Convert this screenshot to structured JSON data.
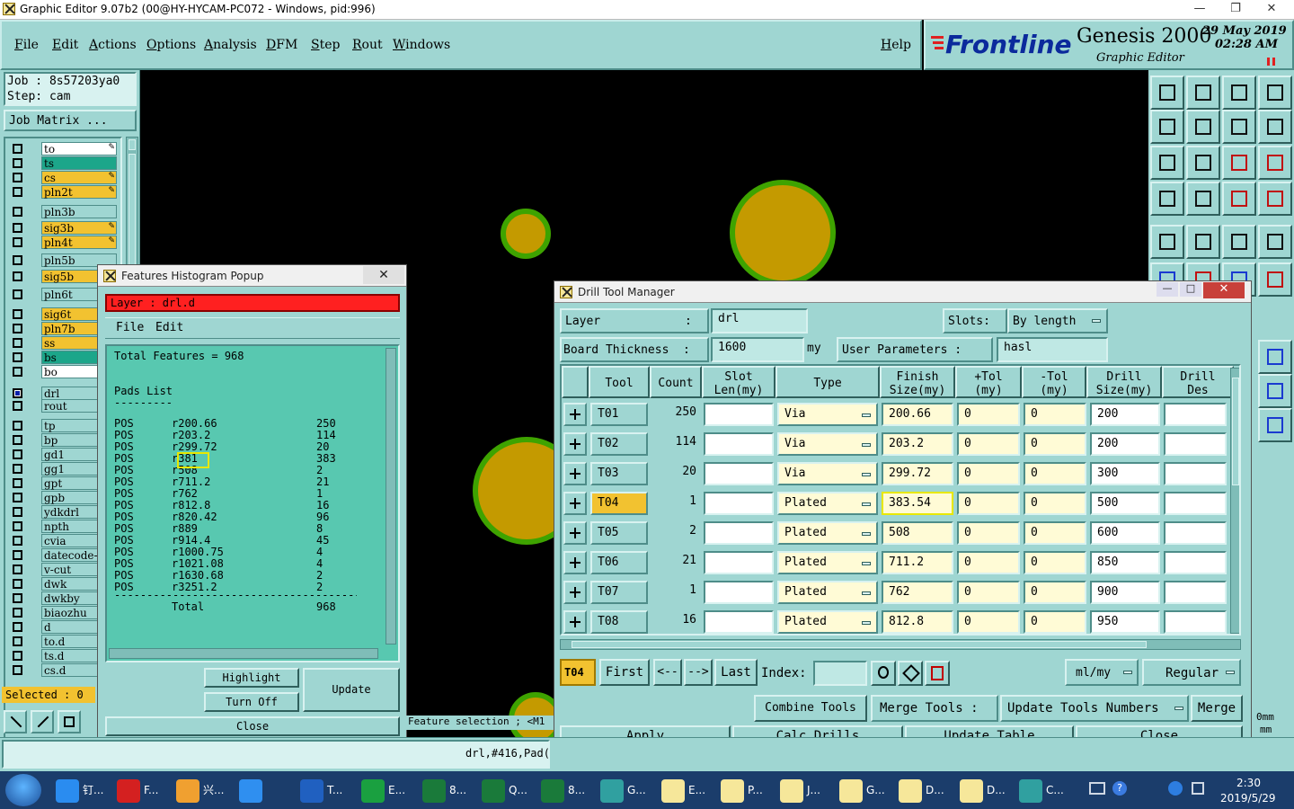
{
  "app": {
    "title": "Graphic Editor 9.07b2 (00@HY-HYCAM-PC072 - Windows, pid:996)",
    "menus": [
      "File",
      "Edit",
      "Actions",
      "Options",
      "Analysis",
      "DFM",
      "Step",
      "Rout",
      "Windows"
    ],
    "help": "Help",
    "brand": "Frontline",
    "product": "Genesis 2000",
    "subtitle": "Graphic Editor",
    "date": "29 May 2019",
    "time": "02:28 AM"
  },
  "left": {
    "job": "Job : 8s57203ya0",
    "step": "Step: cam",
    "job_matrix": "Job Matrix ...",
    "layers": [
      {
        "name": "to",
        "color": "#ffffff",
        "flag": "✎"
      },
      {
        "name": "ts",
        "color": "#1ca68a",
        "flag": ""
      },
      {
        "name": "cs",
        "color": "#f2c230",
        "flag": "✎"
      },
      {
        "name": "pln2t",
        "color": "#f2c230",
        "flag": "✎"
      },
      {
        "name": "pln3b",
        "color": "#9fd6d2",
        "flag": ""
      },
      {
        "name": "sig3b",
        "color": "#f2c230",
        "flag": "✎"
      },
      {
        "name": "pln4t",
        "color": "#f2c230",
        "flag": "✎"
      },
      {
        "name": "pln5b",
        "color": "#9fd6d2",
        "flag": ""
      },
      {
        "name": "sig5b",
        "color": "#f2c230",
        "flag": ""
      },
      {
        "name": "pln6t",
        "color": "#9fd6d2",
        "flag": ""
      },
      {
        "name": "sig6t",
        "color": "#f2c230",
        "flag": ""
      },
      {
        "name": "pln7b",
        "color": "#f2c230",
        "flag": ""
      },
      {
        "name": "ss",
        "color": "#f2c230",
        "flag": ""
      },
      {
        "name": "bs",
        "color": "#1ca68a",
        "flag": ""
      },
      {
        "name": "bo",
        "color": "#ffffff",
        "flag": ""
      },
      {
        "name": "drl",
        "color": "#9fd6d2",
        "flag": ""
      },
      {
        "name": "rout",
        "color": "#9fd6d2",
        "flag": ""
      },
      {
        "name": "tp",
        "color": "#9fd6d2",
        "flag": ""
      },
      {
        "name": "bp",
        "color": "#9fd6d2",
        "flag": ""
      },
      {
        "name": "gd1",
        "color": "#9fd6d2",
        "flag": ""
      },
      {
        "name": "gg1",
        "color": "#9fd6d2",
        "flag": ""
      },
      {
        "name": "gpt",
        "color": "#9fd6d2",
        "flag": ""
      },
      {
        "name": "gpb",
        "color": "#9fd6d2",
        "flag": ""
      },
      {
        "name": "ydkdrl",
        "color": "#9fd6d2",
        "flag": ""
      },
      {
        "name": "npth",
        "color": "#9fd6d2",
        "flag": ""
      },
      {
        "name": "cvia",
        "color": "#9fd6d2",
        "flag": ""
      },
      {
        "name": "datecode-",
        "color": "#9fd6d2",
        "flag": ""
      },
      {
        "name": "v-cut",
        "color": "#9fd6d2",
        "flag": ""
      },
      {
        "name": "dwk",
        "color": "#9fd6d2",
        "flag": ""
      },
      {
        "name": "dwkby",
        "color": "#9fd6d2",
        "flag": ""
      },
      {
        "name": "biaozhu",
        "color": "#9fd6d2",
        "flag": ""
      },
      {
        "name": "d",
        "color": "#9fd6d2",
        "flag": ""
      },
      {
        "name": "to.d",
        "color": "#9fd6d2",
        "flag": ""
      },
      {
        "name": "ts.d",
        "color": "#9fd6d2",
        "flag": ""
      },
      {
        "name": "cs.d",
        "color": "#9fd6d2",
        "flag": ""
      }
    ],
    "selected": "Selected : 0"
  },
  "histogram": {
    "title": "Features Histogram Popup",
    "layer": "Layer :  drl.d",
    "file": "File",
    "edit": "Edit",
    "total_features": "Total Features = 968",
    "pads_list": "Pads List",
    "underline": "---------",
    "rows": [
      [
        "POS",
        "r200.66",
        "250"
      ],
      [
        "POS",
        "r203.2",
        "114"
      ],
      [
        "POS",
        "r299.72",
        "20"
      ],
      [
        "POS",
        "r381",
        "383"
      ],
      [
        "POS",
        "r508",
        "2"
      ],
      [
        "POS",
        "r711.2",
        "21"
      ],
      [
        "POS",
        "r762",
        "1"
      ],
      [
        "POS",
        "r812.8",
        "16"
      ],
      [
        "POS",
        "r820.42",
        "96"
      ],
      [
        "POS",
        "r889",
        "8"
      ],
      [
        "POS",
        "r914.4",
        "45"
      ],
      [
        "POS",
        "r1000.75",
        "4"
      ],
      [
        "POS",
        "r1021.08",
        "4"
      ],
      [
        "POS",
        "r1630.68",
        "2"
      ],
      [
        "POS",
        "r3251.2",
        "2"
      ]
    ],
    "separator": "-----------------------------------------",
    "total_label": "Total",
    "total_value": "968",
    "highlight": "Highlight",
    "turn_off": "Turn Off",
    "update": "Update",
    "close": "Close"
  },
  "dtm": {
    "title": "Drill Tool Manager",
    "layer_label": "Layer            :",
    "layer_value": "drl",
    "slots_label": "Slots:",
    "slots_value": "By length",
    "board_label": "Board Thickness  :",
    "board_value": "1600",
    "board_unit": "my",
    "user_params_label": "User Parameters :",
    "user_params_value": "hasl",
    "headers": [
      "Tool",
      "Count",
      "Slot\nLen(my)",
      "Type",
      "Finish\nSize(my)",
      "+Tol\n(my)",
      "-Tol\n(my)",
      "Drill\nSize(my)",
      "Drill\nDes"
    ],
    "rows": [
      {
        "tool": "T01",
        "count": "250",
        "type": "Via",
        "finish": "200.66",
        "ptol": "0",
        "ntol": "0",
        "drill": "200"
      },
      {
        "tool": "T02",
        "count": "114",
        "type": "Via",
        "finish": "203.2",
        "ptol": "0",
        "ntol": "0",
        "drill": "200"
      },
      {
        "tool": "T03",
        "count": "20",
        "type": "Via",
        "finish": "299.72",
        "ptol": "0",
        "ntol": "0",
        "drill": "300"
      },
      {
        "tool": "T04",
        "count": "1",
        "type": "Plated",
        "finish": "383.54",
        "ptol": "0",
        "ntol": "0",
        "drill": "500"
      },
      {
        "tool": "T05",
        "count": "2",
        "type": "Plated",
        "finish": "508",
        "ptol": "0",
        "ntol": "0",
        "drill": "600"
      },
      {
        "tool": "T06",
        "count": "21",
        "type": "Plated",
        "finish": "711.2",
        "ptol": "0",
        "ntol": "0",
        "drill": "850"
      },
      {
        "tool": "T07",
        "count": "1",
        "type": "Plated",
        "finish": "762",
        "ptol": "0",
        "ntol": "0",
        "drill": "900"
      },
      {
        "tool": "T08",
        "count": "16",
        "type": "Plated",
        "finish": "812.8",
        "ptol": "0",
        "ntol": "0",
        "drill": "950"
      }
    ],
    "current_tool": "T04",
    "nav": [
      "First",
      "<--",
      "-->",
      "Last"
    ],
    "index_label": "Index:",
    "units": "ml/my",
    "mode": "Regular",
    "combine": "Combine Tools",
    "merge_tools": "Merge Tools :",
    "update_numbers": "Update Tools Numbers",
    "merge": "Merge",
    "apply": "Apply",
    "calc": "Calc Drills",
    "update_table": "Update Table",
    "close": "Close"
  },
  "status": {
    "feature_selection": "Feature selection ; <M1",
    "pad_info": "drl,#416,Pad(",
    "right_hint1": "0mm",
    "right_hint2": "mm"
  },
  "taskbar": {
    "tasks": [
      {
        "label": "钉...",
        "color": "#2a8cf0"
      },
      {
        "label": "F...",
        "color": "#d42020"
      },
      {
        "label": "兴...",
        "color": "#f0a030"
      },
      {
        "label": "",
        "color": "#2f8ff0"
      },
      {
        "label": "T...",
        "color": "#2060c0"
      },
      {
        "label": "E...",
        "color": "#1aa040"
      },
      {
        "label": "8...",
        "color": "#1a7a3a"
      },
      {
        "label": "Q...",
        "color": "#1a7a3a"
      },
      {
        "label": "8...",
        "color": "#1a7a3a"
      },
      {
        "label": "G...",
        "color": "#30a0a0"
      },
      {
        "label": "E...",
        "color": "#f6e79a"
      },
      {
        "label": "P...",
        "color": "#f6e79a"
      },
      {
        "label": "J...",
        "color": "#f6e79a"
      },
      {
        "label": "G...",
        "color": "#f6e79a"
      },
      {
        "label": "D...",
        "color": "#f6e79a"
      },
      {
        "label": "D...",
        "color": "#f6e79a"
      },
      {
        "label": "C...",
        "color": "#30a0a0"
      }
    ],
    "clock_time": "2:30",
    "clock_date": "2019/5/29"
  }
}
